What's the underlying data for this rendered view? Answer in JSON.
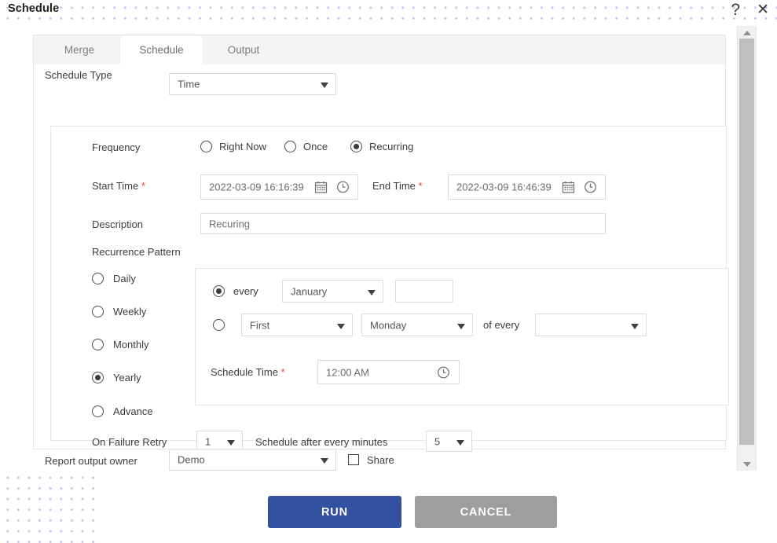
{
  "window": {
    "title": "Schedule",
    "help_icon": "question-mark-icon",
    "close_icon": "close-x-icon",
    "help_label": "?",
    "close_label": "✕"
  },
  "tabs": [
    {
      "label": "Merge",
      "active": false
    },
    {
      "label": "Schedule",
      "active": true
    },
    {
      "label": "Output",
      "active": false
    }
  ],
  "form": {
    "schedule_type": {
      "label": "Schedule Type",
      "value": "Time",
      "options": [
        "Time"
      ]
    },
    "frequency": {
      "label": "Frequency",
      "options": [
        {
          "label": "Right Now",
          "selected": false
        },
        {
          "label": "Once",
          "selected": false
        },
        {
          "label": "Recurring",
          "selected": true
        }
      ]
    },
    "start_time": {
      "label": "Start Time",
      "required": "*",
      "value": "2022-03-09 16:16:39",
      "calendar_icon": "calendar-icon",
      "clock_icon": "clock-icon"
    },
    "end_time": {
      "label": "End Time",
      "required": "*",
      "value": "2022-03-09 16:46:39",
      "calendar_icon": "calendar-icon",
      "clock_icon": "clock-icon"
    },
    "description": {
      "label": "Description",
      "value": "Recuring"
    },
    "recurrence_pattern": {
      "label": "Recurrence Pattern",
      "options": [
        {
          "label": "Daily",
          "selected": false
        },
        {
          "label": "Weekly",
          "selected": false
        },
        {
          "label": "Monthly",
          "selected": false
        },
        {
          "label": "Yearly",
          "selected": true
        },
        {
          "label": "Advance",
          "selected": false
        }
      ]
    },
    "yearly": {
      "mode_every": {
        "selected": true,
        "label": "every"
      },
      "month": {
        "value": "January",
        "options": [
          "January"
        ]
      },
      "day_number": {
        "value": ""
      },
      "mode_ordinal": {
        "selected": false
      },
      "ordinal": {
        "value": "First",
        "options": [
          "First"
        ]
      },
      "weekday": {
        "value": "Monday",
        "options": [
          "Monday"
        ]
      },
      "of_every_label": "of every",
      "of_every_month": {
        "value": "",
        "options": []
      },
      "schedule_time": {
        "label": "Schedule Time",
        "required": "*",
        "value": "12:00 AM",
        "clock_icon": "clock-icon"
      }
    },
    "on_failure_retry": {
      "label": "On Failure Retry",
      "value": "1",
      "options": [
        "1"
      ]
    },
    "schedule_after": {
      "label": "Schedule after every minutes",
      "value": "5",
      "options": [
        "5"
      ]
    },
    "report_output_owner": {
      "label": "Report output owner",
      "value": "Demo",
      "options": [
        "Demo"
      ]
    },
    "share": {
      "label": "Share",
      "checked": false
    }
  },
  "footer": {
    "run_label": "RUN",
    "cancel_label": "CANCEL",
    "run_color": "#3450a0",
    "cancel_color": "#9e9e9e"
  },
  "scrollbar": {
    "up_icon": "scroll-up-arrow-icon",
    "down_icon": "scroll-down-arrow-icon"
  }
}
